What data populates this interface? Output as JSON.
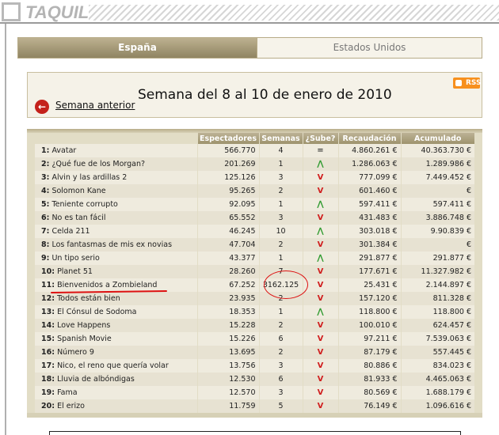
{
  "header": {
    "title": "TAQUILLA"
  },
  "tabs": [
    {
      "label": "España",
      "active": true
    },
    {
      "label": "Estados Unidos",
      "active": false
    }
  ],
  "week": {
    "title": "Semana del 8 al 10 de enero de 2010",
    "prev_label": "Semana anterior",
    "rss_label": "RSS"
  },
  "table": {
    "columns": [
      "Espectadores",
      "Semanas",
      "¿Sube?",
      "Recaudación",
      "Acumulado"
    ],
    "rows": [
      {
        "rank": "1:",
        "title": "Avatar",
        "viewers": "566.770",
        "weeks": "4",
        "trend": "eq",
        "revenue": "4.860.261 €",
        "cumulative": "40.363.730 €"
      },
      {
        "rank": "2:",
        "title": "¿Qué fue de los Morgan?",
        "viewers": "201.269",
        "weeks": "1",
        "trend": "up",
        "revenue": "1.286.063 €",
        "cumulative": "1.289.986 €"
      },
      {
        "rank": "3:",
        "title": "Alvin y las ardillas 2",
        "viewers": "125.126",
        "weeks": "3",
        "trend": "down",
        "revenue": "777.099 €",
        "cumulative": "7.449.452 €"
      },
      {
        "rank": "4:",
        "title": "Solomon Kane",
        "viewers": "95.265",
        "weeks": "2",
        "trend": "down",
        "revenue": "601.460 €",
        "cumulative": "€"
      },
      {
        "rank": "5:",
        "title": "Teniente corrupto",
        "viewers": "92.095",
        "weeks": "1",
        "trend": "up",
        "revenue": "597.411 €",
        "cumulative": "597.411 €"
      },
      {
        "rank": "6:",
        "title": "No es tan fácil",
        "viewers": "65.552",
        "weeks": "3",
        "trend": "down",
        "revenue": "431.483 €",
        "cumulative": "3.886.748 €"
      },
      {
        "rank": "7:",
        "title": "Celda 211",
        "viewers": "46.245",
        "weeks": "10",
        "trend": "up",
        "revenue": "303.018 €",
        "cumulative": "9.90.839 €"
      },
      {
        "rank": "8:",
        "title": "Los fantasmas de mis ex novias",
        "viewers": "47.704",
        "weeks": "2",
        "trend": "down",
        "revenue": "301.384 €",
        "cumulative": "€"
      },
      {
        "rank": "9:",
        "title": "Un tipo serio",
        "viewers": "43.377",
        "weeks": "1",
        "trend": "up",
        "revenue": "291.877 €",
        "cumulative": "291.877 €"
      },
      {
        "rank": "10:",
        "title": "Planet 51",
        "viewers": "28.260",
        "weeks": "7",
        "trend": "down",
        "revenue": "177.671 €",
        "cumulative": "11.327.982 €"
      },
      {
        "rank": "11:",
        "title": "Bienvenidos a Zombieland",
        "viewers": "67.252",
        "weeks": "3162.125",
        "trend": "down",
        "revenue": "25.431 €",
        "cumulative": "2.144.897 €"
      },
      {
        "rank": "12:",
        "title": "Todos están bien",
        "viewers": "23.935",
        "weeks": "2",
        "trend": "down",
        "revenue": "157.120 €",
        "cumulative": "811.328 €"
      },
      {
        "rank": "13:",
        "title": "El Cónsul de Sodoma",
        "viewers": "18.353",
        "weeks": "1",
        "trend": "up",
        "revenue": "118.800 €",
        "cumulative": "118.800 €"
      },
      {
        "rank": "14:",
        "title": "Love Happens",
        "viewers": "15.228",
        "weeks": "2",
        "trend": "down",
        "revenue": "100.010 €",
        "cumulative": "624.457 €"
      },
      {
        "rank": "15:",
        "title": "Spanish Movie",
        "viewers": "15.226",
        "weeks": "6",
        "trend": "down",
        "revenue": "97.211 €",
        "cumulative": "7.539.063 €"
      },
      {
        "rank": "16:",
        "title": "Número 9",
        "viewers": "13.695",
        "weeks": "2",
        "trend": "down",
        "revenue": "87.179 €",
        "cumulative": "557.445 €"
      },
      {
        "rank": "17:",
        "title": "Nico, el reno que quería volar",
        "viewers": "13.756",
        "weeks": "3",
        "trend": "down",
        "revenue": "80.886 €",
        "cumulative": "834.023 €"
      },
      {
        "rank": "18:",
        "title": "Lluvia de albóndigas",
        "viewers": "12.530",
        "weeks": "6",
        "trend": "down",
        "revenue": "81.933 €",
        "cumulative": "4.465.063 €"
      },
      {
        "rank": "19:",
        "title": "Fama",
        "viewers": "12.570",
        "weeks": "3",
        "trend": "down",
        "revenue": "80.569 €",
        "cumulative": "1.688.179 €"
      },
      {
        "rank": "20:",
        "title": "El erizo",
        "viewers": "11.759",
        "weeks": "5",
        "trend": "down",
        "revenue": "76.149 €",
        "cumulative": "1.096.616 €"
      }
    ]
  },
  "arrows": {
    "up": "⋀",
    "down": "V",
    "eq": "="
  },
  "colors": {
    "up": "#2e9a2e",
    "down": "#d01e1e",
    "annotation": "#dd1111",
    "header_bg": "#9e936d"
  }
}
